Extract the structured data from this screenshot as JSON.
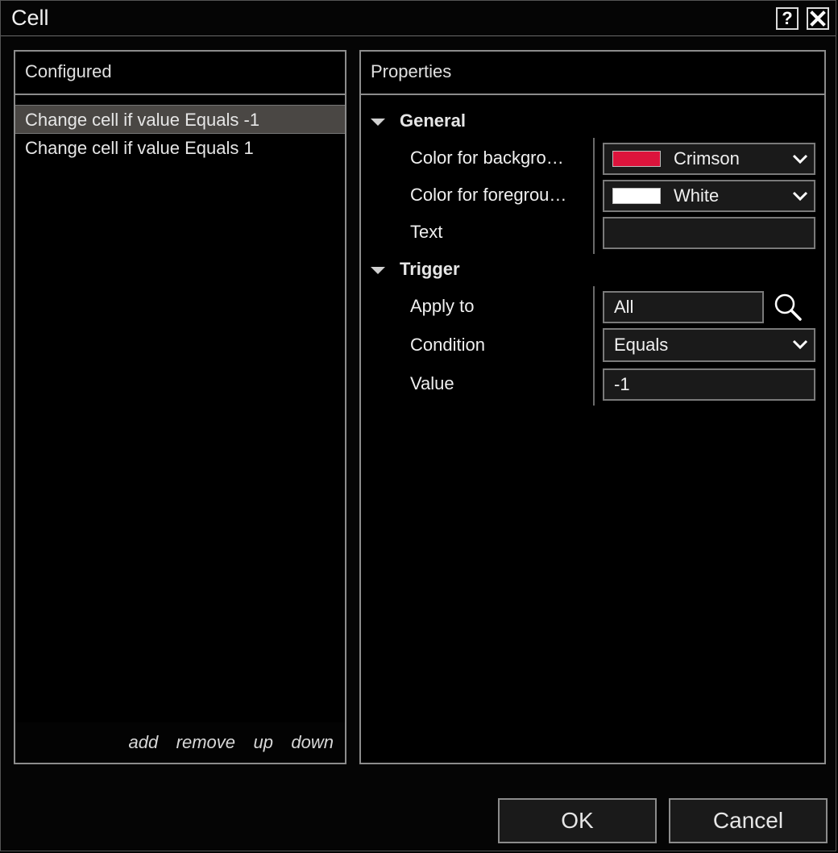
{
  "window": {
    "title": "Cell",
    "help_glyph": "?",
    "close_icon": "close-icon"
  },
  "configured": {
    "header": "Configured",
    "items": [
      {
        "label": "Change cell if value Equals -1",
        "selected": true
      },
      {
        "label": "Change cell if value Equals 1",
        "selected": false
      }
    ],
    "footer": {
      "add": "add",
      "remove": "remove",
      "up": "up",
      "down": "down"
    }
  },
  "properties": {
    "header": "Properties",
    "general": {
      "label": "General",
      "background": {
        "label": "Color for backgro…",
        "value": "Crimson",
        "color": "#dc143c"
      },
      "foreground": {
        "label": "Color for foregrou…",
        "value": "White",
        "color": "#ffffff"
      },
      "text": {
        "label": "Text",
        "value": ""
      }
    },
    "trigger": {
      "label": "Trigger",
      "apply_to": {
        "label": "Apply to",
        "value": "All",
        "icon": "search-icon"
      },
      "condition": {
        "label": "Condition",
        "value": "Equals"
      },
      "value": {
        "label": "Value",
        "value": "-1"
      }
    }
  },
  "buttons": {
    "ok": "OK",
    "cancel": "Cancel"
  }
}
